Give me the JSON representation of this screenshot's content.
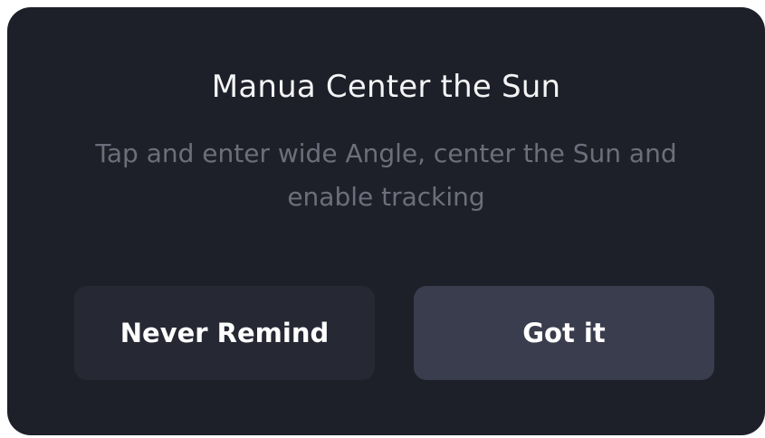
{
  "dialog": {
    "title": "Manua Center the Sun",
    "message": "Tap and enter wide Angle, center the Sun and enable tracking",
    "buttons": {
      "never_remind": "Never Remind",
      "got_it": "Got it"
    }
  }
}
